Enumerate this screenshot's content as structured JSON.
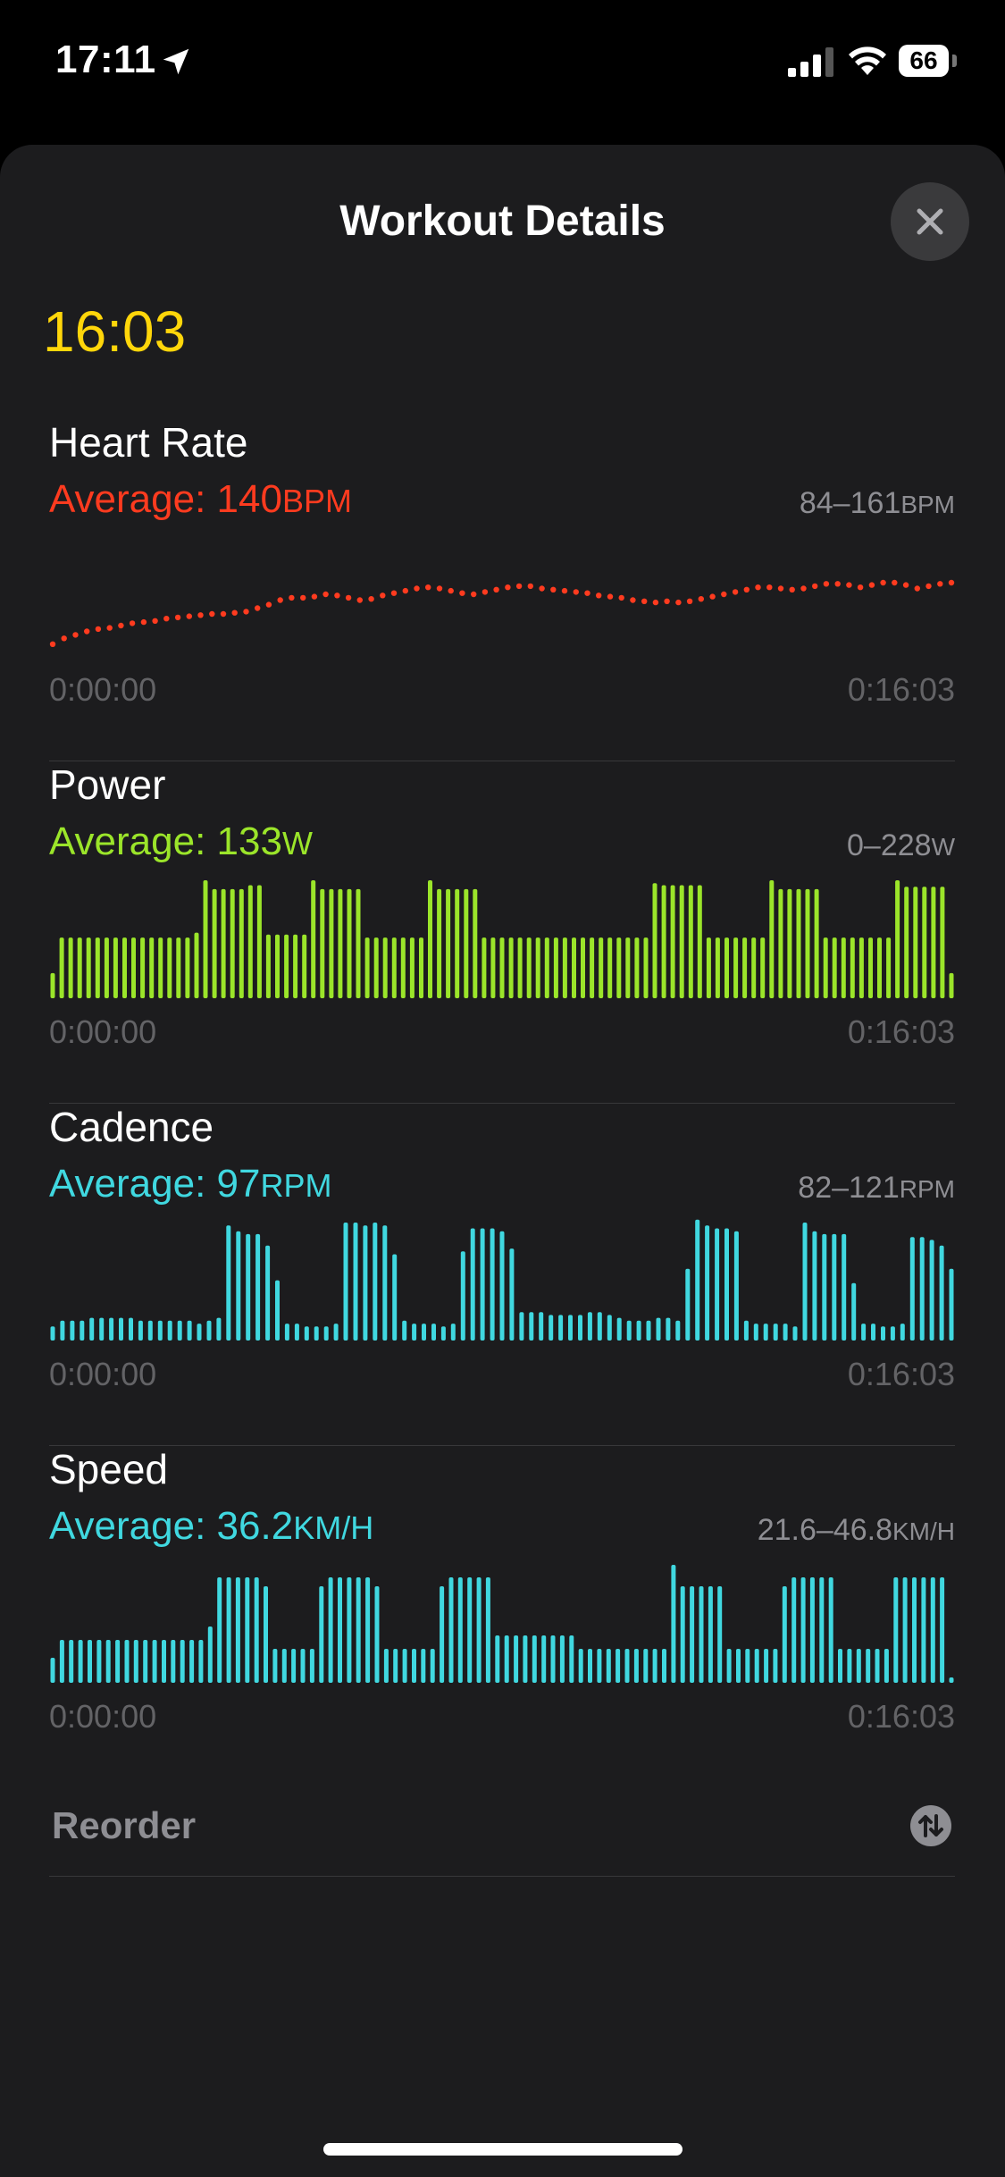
{
  "status_bar": {
    "time": "17:11",
    "battery": "66"
  },
  "sheet": {
    "title": "Workout Details",
    "close_icon": "close-icon",
    "duration": "16:03"
  },
  "metrics": [
    {
      "name": "Heart Rate",
      "average_label": "Average: ",
      "average_value": "140",
      "average_unit": "BPM",
      "range_value": "84–161",
      "range_unit": "BPM",
      "color": "#ff3b1f",
      "start_time": "0:00:00",
      "end_time": "0:16:03"
    },
    {
      "name": "Power",
      "average_label": "Average: ",
      "average_value": "133",
      "average_unit": "W",
      "range_value": "0–228",
      "range_unit": "W",
      "color": "#9be52a",
      "start_time": "0:00:00",
      "end_time": "0:16:03"
    },
    {
      "name": "Cadence",
      "average_label": "Average: ",
      "average_value": "97",
      "average_unit": "RPM",
      "range_value": "82–121",
      "range_unit": "RPM",
      "color": "#40d8e0",
      "start_time": "0:00:00",
      "end_time": "0:16:03"
    },
    {
      "name": "Speed",
      "average_label": "Average: ",
      "average_value": "36.2",
      "average_unit": "KM/H",
      "range_value": "21.6–46.8",
      "range_unit": "KM/H",
      "color": "#40d8e0",
      "start_time": "0:00:00",
      "end_time": "0:16:03"
    }
  ],
  "reorder": {
    "label": "Reorder",
    "icon": "swap-arrows-icon"
  },
  "chart_data": [
    {
      "type": "scatter",
      "title": "Heart Rate",
      "ylim": [
        84,
        161
      ],
      "xlim": [
        "0:00:00",
        "0:16:03"
      ],
      "values": [
        88,
        93,
        96,
        99,
        101,
        102,
        104,
        106,
        107,
        108,
        110,
        111,
        112,
        113,
        114,
        114,
        115,
        116,
        119,
        122,
        126,
        128,
        128,
        129,
        131,
        130,
        128,
        126,
        127,
        130,
        132,
        134,
        136,
        137,
        136,
        134,
        132,
        131,
        133,
        135,
        137,
        138,
        138,
        136,
        135,
        134,
        133,
        132,
        130,
        129,
        128,
        126,
        125,
        124,
        125,
        124,
        125,
        127,
        129,
        131,
        133,
        135,
        137,
        137,
        136,
        135,
        136,
        138,
        140,
        140,
        139,
        137,
        139,
        141,
        141,
        139,
        136,
        138,
        140,
        141
      ]
    },
    {
      "type": "bar",
      "title": "Power",
      "ylim": [
        0,
        228
      ],
      "xlim": [
        "0:00:00",
        "0:16:03"
      ],
      "values": [
        40,
        112,
        112,
        112,
        112,
        112,
        112,
        112,
        112,
        112,
        112,
        112,
        112,
        112,
        112,
        112,
        122,
        228,
        210,
        210,
        210,
        210,
        218,
        218,
        118,
        118,
        118,
        118,
        118,
        228,
        210,
        210,
        210,
        210,
        210,
        112,
        112,
        112,
        112,
        112,
        112,
        112,
        228,
        210,
        210,
        210,
        210,
        210,
        112,
        112,
        112,
        112,
        112,
        112,
        112,
        112,
        112,
        112,
        112,
        112,
        112,
        112,
        112,
        112,
        112,
        112,
        112,
        222,
        218,
        218,
        218,
        218,
        218,
        112,
        112,
        112,
        112,
        112,
        112,
        112,
        228,
        210,
        210,
        210,
        210,
        210,
        112,
        112,
        112,
        112,
        112,
        112,
        112,
        112,
        228,
        215,
        215,
        215,
        215,
        215,
        40
      ]
    },
    {
      "type": "bar",
      "title": "Cadence",
      "ylim": [
        82,
        121
      ],
      "xlim": [
        "0:00:00",
        "0:16:03"
      ],
      "values": [
        85,
        87,
        87,
        87,
        88,
        88,
        88,
        88,
        88,
        87,
        87,
        87,
        87,
        87,
        87,
        86,
        87,
        88,
        120,
        118,
        117,
        117,
        113,
        101,
        86,
        86,
        85,
        85,
        85,
        86,
        121,
        121,
        120,
        121,
        120,
        110,
        87,
        86,
        86,
        86,
        85,
        86,
        111,
        119,
        119,
        119,
        118,
        112,
        90,
        90,
        90,
        89,
        89,
        89,
        89,
        90,
        90,
        89,
        88,
        87,
        87,
        87,
        88,
        88,
        87,
        105,
        122,
        120,
        119,
        119,
        118,
        87,
        86,
        86,
        86,
        86,
        85,
        121,
        118,
        117,
        117,
        117,
        100,
        86,
        86,
        85,
        85,
        86,
        116,
        116,
        115,
        113,
        105
      ]
    },
    {
      "type": "bar",
      "title": "Speed",
      "ylim": [
        21.6,
        46.8
      ],
      "xlim": [
        "0:00:00",
        "0:16:03"
      ],
      "values": [
        26,
        30,
        30,
        30,
        30,
        30,
        30,
        30,
        30,
        30,
        30,
        30,
        30,
        30,
        30,
        30,
        30,
        33,
        44,
        44,
        44,
        44,
        44,
        42,
        28,
        28,
        28,
        28,
        28,
        42,
        44,
        44,
        44,
        44,
        44,
        42,
        28,
        28,
        28,
        28,
        28,
        28,
        42,
        44,
        44,
        44,
        44,
        44,
        31,
        31,
        31,
        31,
        31,
        31,
        31,
        31,
        31,
        28,
        28,
        28,
        28,
        28,
        28,
        28,
        28,
        28,
        28,
        46.8,
        42,
        42,
        42,
        42,
        42,
        28,
        28,
        28,
        28,
        28,
        28,
        42,
        44,
        44,
        44,
        44,
        44,
        28,
        28,
        28,
        28,
        28,
        28,
        44,
        44,
        44,
        44,
        44,
        44,
        21.6
      ]
    }
  ]
}
